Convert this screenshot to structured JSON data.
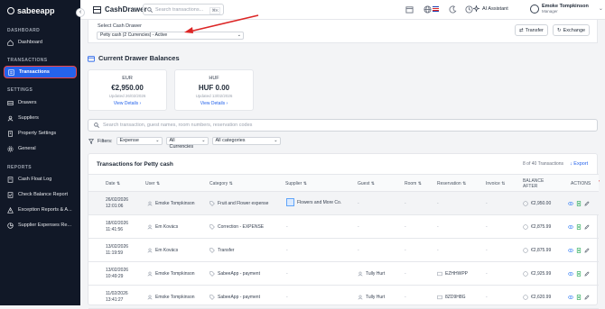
{
  "app": {
    "brand": "sabeeapp"
  },
  "sidebar": {
    "sections": [
      {
        "label": "DASHBOARD",
        "items": [
          {
            "label": "Dashboard",
            "icon": "home-icon"
          }
        ]
      },
      {
        "label": "TRANSACTIONS",
        "items": [
          {
            "label": "Transactions",
            "icon": "receipt-icon",
            "active": true
          }
        ]
      },
      {
        "label": "SETTINGS",
        "items": [
          {
            "label": "Drawers",
            "icon": "drawer-icon"
          },
          {
            "label": "Suppliers",
            "icon": "users-icon"
          },
          {
            "label": "Property Settings",
            "icon": "building-icon"
          },
          {
            "label": "General",
            "icon": "gear-icon"
          }
        ]
      },
      {
        "label": "REPORTS",
        "items": [
          {
            "label": "Cash Float Log",
            "icon": "log-icon"
          },
          {
            "label": "Check Balance Report",
            "icon": "report-icon"
          },
          {
            "label": "Exception Reports & A...",
            "icon": "alert-icon"
          },
          {
            "label": "Supplier Expenses Re...",
            "icon": "chart-icon"
          }
        ]
      }
    ]
  },
  "topbar": {
    "title": "CashDrawer",
    "search_placeholder": "Search transactions...",
    "search_shortcut": "⌘K",
    "ai_label": "AI Assistant",
    "user_name": "Emoke Tompkinson",
    "user_role": "Manager"
  },
  "drawer": {
    "label": "Select Cash Drawer",
    "selected": "Petty cash (2 Currencies) - Active",
    "transfer_label": "Transfer",
    "exchange_label": "Exchange"
  },
  "balances": {
    "title": "Current Drawer Balances",
    "cards": [
      {
        "currency": "EUR",
        "amount": "€2,950.00",
        "updated": "Updated 26/02/2026",
        "link": "View Details"
      },
      {
        "currency": "HUF",
        "amount": "HUF 0.00",
        "updated": "Updated 13/02/2026",
        "link": "View Details"
      }
    ]
  },
  "search": {
    "placeholder": "Search transaction, guest names, room numbers, reservation codes"
  },
  "filters": {
    "label": "Filters:",
    "type": "Expense",
    "currency": "All Currencies",
    "category": "All categories"
  },
  "table": {
    "title": "Transactions for Petty cash",
    "count": "8 of 40 Transactions",
    "export_label": "Export",
    "headers": [
      "Date",
      "User",
      "Category",
      "Supplier",
      "Guest",
      "Room",
      "Reservation",
      "Invoice",
      "BALANCE",
      "AFTER",
      "ACTIONS"
    ],
    "rows": [
      {
        "date": "26/02/2026",
        "time": "12:01:06",
        "user": "Emoke Tompkinson",
        "category": "Fruit and Flower expense",
        "supplier": "Flowers and More Co.",
        "guest": "-",
        "room": "-",
        "reservation": "-",
        "invoice": "-",
        "balance": "€2,950.00"
      },
      {
        "date": "18/02/2026",
        "time": "11:41:56",
        "user": "Em Kovács",
        "category": "Correction - EXPENSE",
        "supplier": "-",
        "guest": "-",
        "room": "-",
        "reservation": "-",
        "invoice": "-",
        "balance": "€2,875.99"
      },
      {
        "date": "13/02/2026",
        "time": "11:19:59",
        "user": "Em Kovács",
        "category": "Transfer",
        "supplier": "-",
        "guest": "-",
        "room": "-",
        "reservation": "-",
        "invoice": "-",
        "balance": "€2,875.99"
      },
      {
        "date": "13/02/2026",
        "time": "10:49:29",
        "user": "Emoke Tompkinson",
        "category": "SabeeApp - payment",
        "supplier": "-",
        "guest": "Tully Hurt",
        "room": "-",
        "reservation": "EZHHWPP",
        "invoice": "-",
        "balance": "€2,925.99"
      },
      {
        "date": "11/02/2026",
        "time": "13:41:27",
        "user": "Emoke Tompkinson",
        "category": "SabeeApp - payment",
        "supplier": "-",
        "guest": "Tully Hurt",
        "room": "-",
        "reservation": "8ZD9H8G",
        "invoice": "-",
        "balance": "€2,620.99"
      }
    ]
  },
  "colors": {
    "sidebar_bg": "#111827",
    "accent": "#2563eb",
    "annotation": "#dc2626"
  }
}
